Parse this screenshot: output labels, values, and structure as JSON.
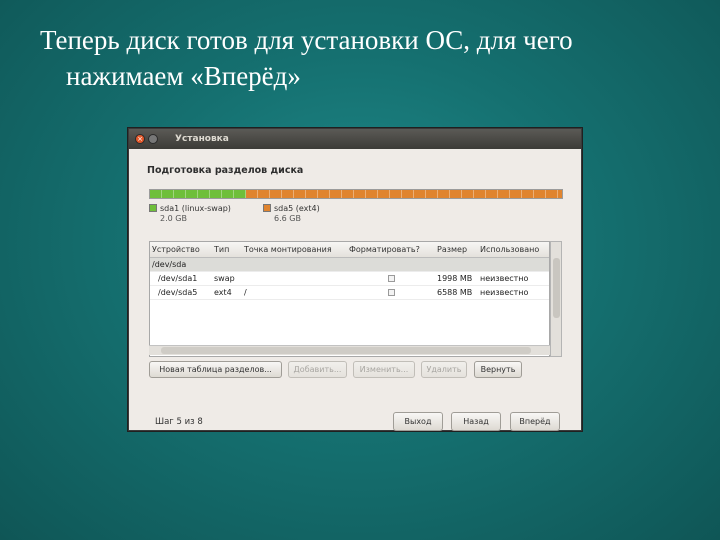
{
  "slide": {
    "title_line1": "Теперь диск готов для установки ОС, для чего",
    "title_line2": "нажимаем «Вперёд»"
  },
  "window": {
    "title": "Установка",
    "heading": "Подготовка разделов диска",
    "partition_bar": [
      {
        "name": "sda1",
        "fraction": 0.233,
        "color": "#6fbf3a"
      },
      {
        "name": "sda5",
        "fraction": 0.767,
        "color": "#e0842f"
      }
    ],
    "legend": [
      {
        "label": "sda1 (linux-swap)",
        "size": "2.0 GB",
        "color": "#6fbf3a"
      },
      {
        "label": "sda5 (ext4)",
        "size": "6.6 GB",
        "color": "#e0842f"
      }
    ],
    "table": {
      "headers": [
        "Устройство",
        "Тип",
        "Точка монтирования",
        "Форматировать?",
        "Размер",
        "Использовано"
      ],
      "rows": [
        {
          "device": "/dev/sda",
          "type": "",
          "mount": "",
          "format": false,
          "size": "",
          "used": "",
          "has_check": false
        },
        {
          "device": "/dev/sda1",
          "type": "swap",
          "mount": "",
          "format": false,
          "size": "1998 MB",
          "used": "неизвестно",
          "has_check": true
        },
        {
          "device": "/dev/sda5",
          "type": "ext4",
          "mount": "/",
          "format": false,
          "size": "6588 MB",
          "used": "неизвестно",
          "has_check": true
        }
      ]
    },
    "buttons": {
      "new_table": "Новая таблица разделов...",
      "add": "Добавить...",
      "change": "Изменить...",
      "delete": "Удалить",
      "revert": "Вернуть",
      "quit": "Выход",
      "back": "Назад",
      "forward": "Вперёд"
    },
    "step": "Шаг 5 из 8"
  }
}
